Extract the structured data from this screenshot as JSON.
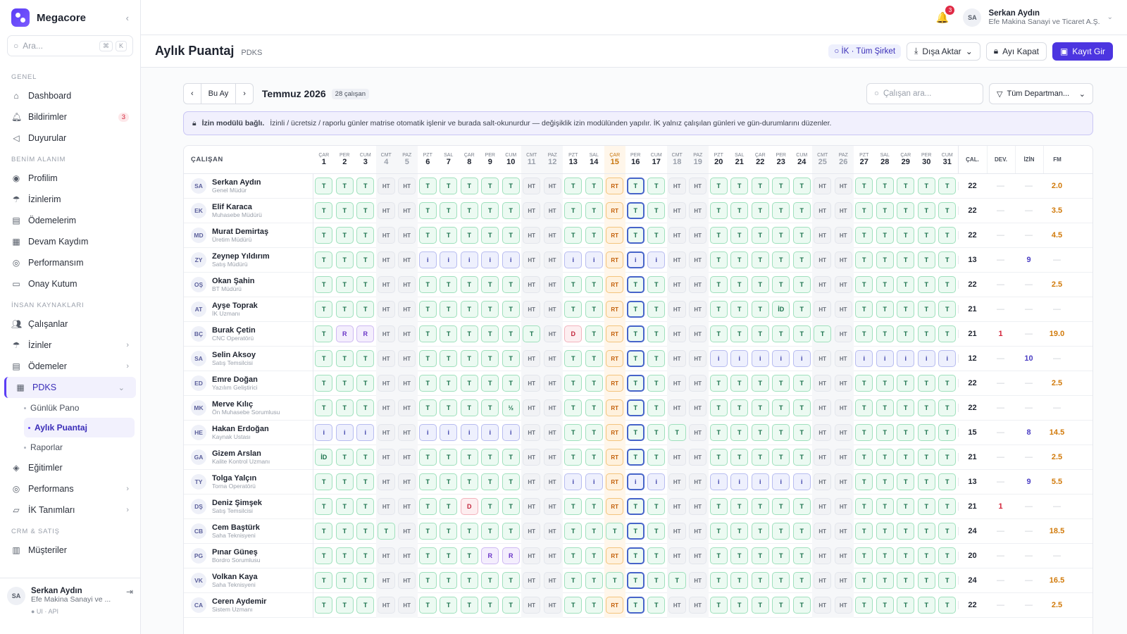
{
  "app": {
    "name": "Megacore"
  },
  "sidebar": {
    "search_placeholder": "Ara...",
    "kbd": [
      "⌘",
      "K"
    ],
    "groups": [
      {
        "label": "GENEL",
        "items": [
          {
            "label": "Dashboard",
            "icon": "home-icon"
          },
          {
            "label": "Bildirimler",
            "icon": "bell-icon",
            "badge": "3"
          },
          {
            "label": "Duyurular",
            "icon": "megaphone-icon"
          }
        ]
      },
      {
        "label": "BENİM ALANIM",
        "items": [
          {
            "label": "Profilim",
            "icon": "user-circle-icon"
          },
          {
            "label": "İzinlerim",
            "icon": "umbrella-icon"
          },
          {
            "label": "Ödemelerim",
            "icon": "wallet-icon"
          },
          {
            "label": "Devam Kaydım",
            "icon": "calendar-icon"
          },
          {
            "label": "Performansım",
            "icon": "target-icon"
          },
          {
            "label": "Onay Kutum",
            "icon": "inbox-icon"
          }
        ]
      },
      {
        "label": "İNSAN KAYNAKLARI",
        "items": [
          {
            "label": "Çalışanlar",
            "icon": "users-icon"
          },
          {
            "label": "İzinler",
            "icon": "umbrella-icon",
            "chevron": true
          },
          {
            "label": "Ödemeler",
            "icon": "wallet-icon",
            "chevron": true
          },
          {
            "label": "PDKS",
            "icon": "calendar-icon",
            "chevron": true,
            "active": true
          }
        ]
      }
    ],
    "pdks_sub": [
      "Günlük Pano",
      "Aylık Puantaj",
      "Raporlar"
    ],
    "after": [
      {
        "label": "Eğitimler",
        "icon": "graduation-icon"
      },
      {
        "label": "Performans",
        "icon": "target-icon",
        "chevron": true
      },
      {
        "label": "İK Tanımları",
        "icon": "folder-icon",
        "chevron": true
      }
    ],
    "crm_label": "CRM & SATIŞ",
    "crm_items": [
      {
        "label": "Müşteriler",
        "icon": "building-icon"
      }
    ],
    "user": {
      "initials": "SA",
      "name": "Serkan Aydın",
      "org": "Efe Makina Sanayi ve ...",
      "foot": "● UI · API"
    }
  },
  "topbar": {
    "notif_count": "3",
    "user_initials": "SA",
    "user_name": "Serkan Aydın",
    "user_org": "Efe Makina Sanayi ve Ticaret A.Ş."
  },
  "header": {
    "title": "Aylık Puantaj",
    "subtitle": "PDKS",
    "scope_chip": "İK · Tüm Şirket",
    "export": "Dışa Aktar",
    "close_month": "Ayı Kapat",
    "entry": "Kayıt Gir"
  },
  "toolbar": {
    "this_month": "Bu Ay",
    "month": "Temmuz 2026",
    "count": "28 çalışan",
    "search_placeholder": "Çalışan ara...",
    "dept": "Tüm Departman..."
  },
  "notice": {
    "bold": "İzin modülü bağlı.",
    "text": "İzinli / ücretsiz / raporlu günler matrise otomatik işlenir ve burada salt-okunurdur — değişiklik izin modülünden yapılır. İK yalnız çalışılan günleri ve gün-durumlarını düzenler."
  },
  "grid": {
    "emp_header": "ÇALIŞAN",
    "stat_headers": [
      "ÇAL.",
      "DEV.",
      "İZİN",
      "FM"
    ],
    "day_names": [
      "ÇAR",
      "PER",
      "CUM",
      "CMT",
      "PAZ",
      "PZT",
      "SAL",
      "ÇAR",
      "PER",
      "CUM",
      "CMT",
      "PAZ",
      "PZT",
      "SAL",
      "ÇAR",
      "PER",
      "CUM",
      "CMT",
      "PAZ",
      "PZT",
      "SAL",
      "ÇAR",
      "PER",
      "CUM",
      "CMT",
      "PAZ",
      "PZT",
      "SAL",
      "ÇAR",
      "PER",
      "CUM"
    ],
    "today": 15,
    "selected": 16,
    "rows": [
      {
        "ini": "SA",
        "name": "Serkan Aydın",
        "role": "Genel Müdür",
        "days": "T T T HT HT T T T T T HT HT T T RT T T HT HT T T T T T HT HT T T T T T",
        "cal": "22",
        "dev": "—",
        "izin": "—",
        "fm": "2.0"
      },
      {
        "ini": "EK",
        "name": "Elif Karaca",
        "role": "Muhasebe Müdürü",
        "days": "T T T HT HT T T T T T HT HT T T RT T T HT HT T T T T T HT HT T T T T T",
        "cal": "22",
        "dev": "—",
        "izin": "—",
        "fm": "3.5"
      },
      {
        "ini": "MD",
        "name": "Murat Demirtaş",
        "role": "Üretim Müdürü",
        "days": "T T T HT HT T T T T T HT HT T T RT T T HT HT T T T T T HT HT T T T T T",
        "cal": "22",
        "dev": "—",
        "izin": "—",
        "fm": "4.5"
      },
      {
        "ini": "ZY",
        "name": "Zeynep Yıldırım",
        "role": "Satış Müdürü",
        "days": "T T T HT HT i i i i i HT HT i i RT i i HT HT T T T T T HT HT T T T T T",
        "cal": "13",
        "dev": "—",
        "izin": "9",
        "fm": "—"
      },
      {
        "ini": "OŞ",
        "name": "Okan Şahin",
        "role": "BT Müdürü",
        "days": "T T T HT HT T T T T T HT HT T T RT T T HT HT T T T T T HT HT T T T T T",
        "cal": "22",
        "dev": "—",
        "izin": "—",
        "fm": "2.5"
      },
      {
        "ini": "AT",
        "name": "Ayşe Toprak",
        "role": "İK Uzmanı",
        "days": "T T T HT HT T T T T T HT HT T T RT T T HT HT T T T İD T HT HT T T T T T",
        "cal": "21",
        "dev": "—",
        "izin": "—",
        "fm": "—"
      },
      {
        "ini": "BÇ",
        "name": "Burak Çetin",
        "role": "CNC Operatörü",
        "days": "T R R HT HT T T T T T T HT D T RT T T HT HT T T T T T T HT T T T T T",
        "cal": "21",
        "dev": "1",
        "izin": "—",
        "fm": "19.0"
      },
      {
        "ini": "SA",
        "name": "Selin Aksoy",
        "role": "Satış Temsilcisi",
        "days": "T T T HT HT T T T T T HT HT T T RT T T HT HT i i i i i HT HT i i i i i",
        "cal": "12",
        "dev": "—",
        "izin": "10",
        "fm": "—"
      },
      {
        "ini": "ED",
        "name": "Emre Doğan",
        "role": "Yazılım Geliştirici",
        "days": "T T T HT HT T T T T T HT HT T T RT T T HT HT T T T T T HT HT T T T T T",
        "cal": "22",
        "dev": "—",
        "izin": "—",
        "fm": "2.5"
      },
      {
        "ini": "MK",
        "name": "Merve Kılıç",
        "role": "Ön Muhasebe Sorumlusu",
        "days": "T T T HT HT T T T T ½ HT HT T T RT T T HT HT T T T T T HT HT T T T T T",
        "cal": "22",
        "dev": "—",
        "izin": "—",
        "fm": "—"
      },
      {
        "ini": "HE",
        "name": "Hakan Erdoğan",
        "role": "Kaynak Ustası",
        "days": "i i i HT HT i i i i i HT HT T T RT T T T HT T T T T T HT HT T T T T T",
        "cal": "15",
        "dev": "—",
        "izin": "8",
        "fm": "14.5"
      },
      {
        "ini": "GA",
        "name": "Gizem Arslan",
        "role": "Kalite Kontrol Uzmanı",
        "days": "İD T T HT HT T T T T T HT HT T T RT T T HT HT T T T T T HT HT T T T T T",
        "cal": "21",
        "dev": "—",
        "izin": "—",
        "fm": "2.5"
      },
      {
        "ini": "TY",
        "name": "Tolga Yalçın",
        "role": "Torna Operatörü",
        "days": "T T T HT HT T T T T T HT HT i i RT i i HT HT i i i i i HT HT T T T T T",
        "cal": "13",
        "dev": "—",
        "izin": "9",
        "fm": "5.5"
      },
      {
        "ini": "DŞ",
        "name": "Deniz Şimşek",
        "role": "Satış Temsilcisi",
        "days": "T T T HT HT T T D T T HT HT T T RT T T HT HT T T T T T HT HT T T T T T",
        "cal": "21",
        "dev": "1",
        "izin": "—",
        "fm": "—"
      },
      {
        "ini": "CB",
        "name": "Cem Baştürk",
        "role": "Saha Teknisyeni",
        "days": "T T T T HT T T T T T HT HT T T T T T HT HT T T T T T HT HT T T T T T",
        "cal": "24",
        "dev": "—",
        "izin": "—",
        "fm": "18.5"
      },
      {
        "ini": "PG",
        "name": "Pınar Güneş",
        "role": "Bordro Sorumlusu",
        "days": "T T T HT HT T T T R R HT HT T T RT T T HT HT T T T T T HT HT T T T T T",
        "cal": "20",
        "dev": "—",
        "izin": "—",
        "fm": "—"
      },
      {
        "ini": "VK",
        "name": "Volkan Kaya",
        "role": "Saha Teknisyeni",
        "days": "T T T HT HT T T T T T HT HT T T T T T T HT T T T T T HT HT T T T T T",
        "cal": "24",
        "dev": "—",
        "izin": "—",
        "fm": "16.5"
      },
      {
        "ini": "CA",
        "name": "Ceren Aydemir",
        "role": "Sistem Uzmanı",
        "days": "T T T HT HT T T T T T HT HT T T RT T T HT HT T T T T T HT HT T T T T T",
        "cal": "22",
        "dev": "—",
        "izin": "—",
        "fm": "2.5"
      }
    ]
  },
  "colors": {
    "accent": "#4c35e0",
    "today": "#c7760e",
    "select": "#4664c9"
  }
}
